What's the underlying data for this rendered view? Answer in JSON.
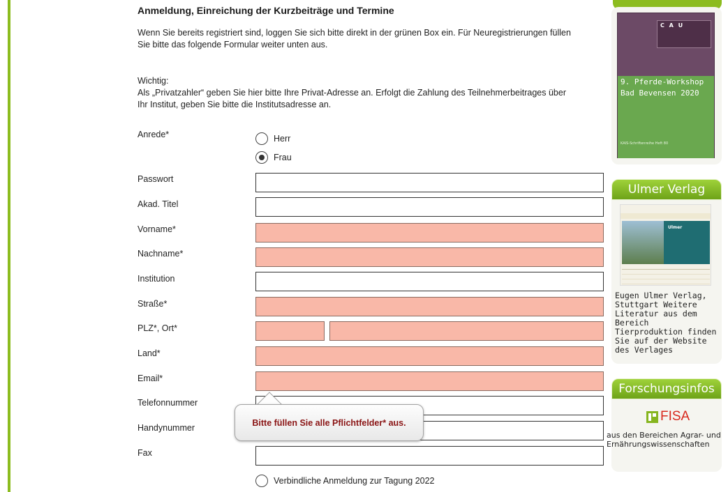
{
  "page": {
    "heading": "Anmeldung, Einreichung der Kurzbeiträge und Termine",
    "intro_line1": "Wenn Sie bereits registriert sind, loggen Sie sich bitte direkt in der grünen Box ein. Für Neuregistrierungen füllen",
    "intro_line2": "Sie bitte das folgende Formular weiter unten aus.",
    "important_title": "Wichtig:",
    "important_line1": "Als „Privatzahler“ geben Sie hier bitte Ihre Privat-Adresse an. Erfolgt die Zahlung des Teilnehmerbeitrages über",
    "important_line2": "Ihr Institut, geben Sie bitte die Institutsadresse an."
  },
  "form": {
    "salutation_label": "Anrede*",
    "salutation_options": [
      "Herr",
      "Frau"
    ],
    "salutation_selected": "Frau",
    "fields": {
      "password": "Passwort",
      "title": "Akad. Titel",
      "first_name": "Vorname*",
      "last_name": "Nachname*",
      "institution": "Institution",
      "street": "Straße*",
      "zip_city": "PLZ*, Ort*",
      "country": "Land*",
      "email": "Email*",
      "phone": "Telefonnummer",
      "mobile": "Handynummer",
      "fax": "Fax"
    },
    "confirm_label": "Verbindliche Anmeldung zur Tagung 2022",
    "validation_message": "Bitte füllen Sie alle Pflichtfelder* aus.",
    "required_color": "#f9b8a8"
  },
  "sidebar": {
    "book": {
      "logo": "C A U",
      "title_line1": "9. Pferde-Workshop",
      "title_line2": "Bad Bevensen 2020",
      "series": "KAIS-Schriftenreihe Heft 80"
    },
    "ulmer": {
      "heading": "Ulmer Verlag",
      "screenshot_brand": "Ulmer",
      "text": "Eugen Ulmer Verlag, Stuttgart Weitere Literatur aus dem Bereich Tierproduktion finden Sie auf der Website des Verlages"
    },
    "research": {
      "heading": "Forschungsinfos",
      "logo_text": "FISA",
      "text": "aus den Bereichen Agrar- und Ernährungswissenschaften"
    },
    "accent_color": "#8cbc1f"
  }
}
